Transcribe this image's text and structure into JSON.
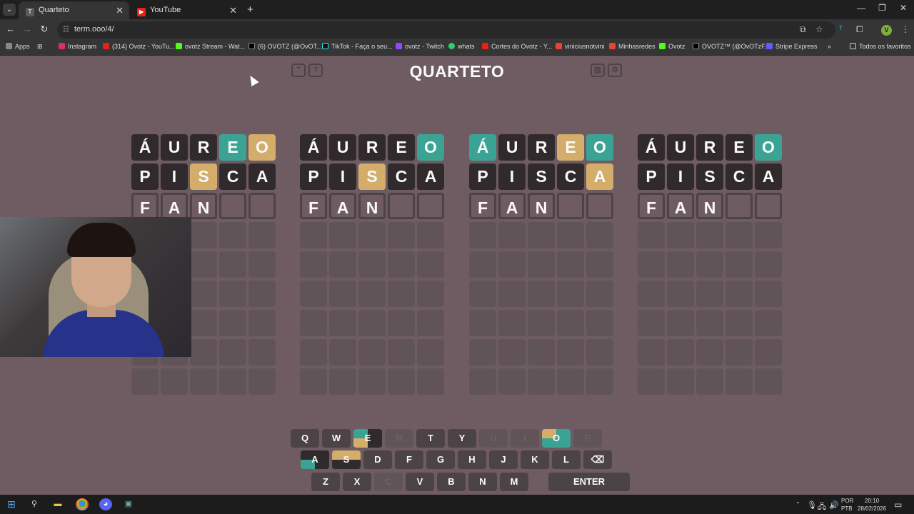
{
  "browser": {
    "tabs": [
      {
        "title": "Quarteto",
        "favicon": "T",
        "active": true
      },
      {
        "title": "YouTube",
        "favicon": "▶",
        "active": false
      }
    ],
    "url": "term.ooo/4/",
    "profile_initial": "V",
    "bookmarks": [
      {
        "label": "Apps",
        "icon": "apps-icon"
      },
      {
        "label": "Instagram",
        "icon": "instagram-icon"
      },
      {
        "label": "(314) Ovotz - YouTu...",
        "icon": "youtube-icon"
      },
      {
        "label": "ovotz Stream - Wat...",
        "icon": "kick-icon"
      },
      {
        "label": "(6) OVOTZ (@OvOT...",
        "icon": "x-icon"
      },
      {
        "label": "TikTok - Faça o seu...",
        "icon": "tiktok-icon"
      },
      {
        "label": "ovotz - Twitch",
        "icon": "twitch-icon"
      },
      {
        "label": "whats",
        "icon": "whatsapp-icon"
      },
      {
        "label": "Cortes do Ovotz - Y...",
        "icon": "youtube-icon"
      },
      {
        "label": "viniciusnotvini",
        "icon": "gmail-icon"
      },
      {
        "label": "Minhasredes",
        "icon": "gmail-icon"
      },
      {
        "label": "Ovotz",
        "icon": "kick-icon"
      },
      {
        "label": "OVOTZ™ (@OvOTzF...",
        "icon": "x-icon"
      },
      {
        "label": "Stripe Express",
        "icon": "stripe-icon"
      }
    ],
    "all_bookmarks_label": "Todos os favoritos"
  },
  "game": {
    "title": "QUARTETO",
    "colors": {
      "correct": "#3aa394",
      "present": "#d3ad69",
      "absent": "#312a2c",
      "background": "#6e5c62"
    },
    "boards": [
      {
        "rows": [
          [
            {
              "l": "Á",
              "s": "miss"
            },
            {
              "l": "U",
              "s": "miss"
            },
            {
              "l": "R",
              "s": "miss"
            },
            {
              "l": "E",
              "s": "ok"
            },
            {
              "l": "O",
              "s": "near"
            }
          ],
          [
            {
              "l": "P",
              "s": "miss"
            },
            {
              "l": "I",
              "s": "miss"
            },
            {
              "l": "S",
              "s": "near"
            },
            {
              "l": "C",
              "s": "miss"
            },
            {
              "l": "A",
              "s": "miss"
            }
          ],
          [
            {
              "l": "F",
              "s": "empty"
            },
            {
              "l": "A",
              "s": "empty"
            },
            {
              "l": "N",
              "s": "empty"
            },
            {
              "l": "",
              "s": "empty"
            },
            {
              "l": "",
              "s": "empty"
            }
          ]
        ]
      },
      {
        "rows": [
          [
            {
              "l": "Á",
              "s": "miss"
            },
            {
              "l": "U",
              "s": "miss"
            },
            {
              "l": "R",
              "s": "miss"
            },
            {
              "l": "E",
              "s": "miss"
            },
            {
              "l": "O",
              "s": "ok"
            }
          ],
          [
            {
              "l": "P",
              "s": "miss"
            },
            {
              "l": "I",
              "s": "miss"
            },
            {
              "l": "S",
              "s": "near"
            },
            {
              "l": "C",
              "s": "miss"
            },
            {
              "l": "A",
              "s": "miss"
            }
          ],
          [
            {
              "l": "F",
              "s": "empty"
            },
            {
              "l": "A",
              "s": "empty"
            },
            {
              "l": "N",
              "s": "empty"
            },
            {
              "l": "",
              "s": "empty"
            },
            {
              "l": "",
              "s": "empty"
            }
          ]
        ]
      },
      {
        "rows": [
          [
            {
              "l": "Á",
              "s": "ok"
            },
            {
              "l": "U",
              "s": "miss"
            },
            {
              "l": "R",
              "s": "miss"
            },
            {
              "l": "E",
              "s": "near"
            },
            {
              "l": "O",
              "s": "ok"
            }
          ],
          [
            {
              "l": "P",
              "s": "miss"
            },
            {
              "l": "I",
              "s": "miss"
            },
            {
              "l": "S",
              "s": "miss"
            },
            {
              "l": "C",
              "s": "miss"
            },
            {
              "l": "A",
              "s": "near"
            }
          ],
          [
            {
              "l": "F",
              "s": "empty"
            },
            {
              "l": "A",
              "s": "empty"
            },
            {
              "l": "N",
              "s": "empty"
            },
            {
              "l": "",
              "s": "empty"
            },
            {
              "l": "",
              "s": "empty"
            }
          ]
        ]
      },
      {
        "rows": [
          [
            {
              "l": "Á",
              "s": "miss"
            },
            {
              "l": "U",
              "s": "miss"
            },
            {
              "l": "R",
              "s": "miss"
            },
            {
              "l": "E",
              "s": "miss"
            },
            {
              "l": "O",
              "s": "ok"
            }
          ],
          [
            {
              "l": "P",
              "s": "miss"
            },
            {
              "l": "I",
              "s": "miss"
            },
            {
              "l": "S",
              "s": "miss"
            },
            {
              "l": "C",
              "s": "miss"
            },
            {
              "l": "A",
              "s": "miss"
            }
          ],
          [
            {
              "l": "F",
              "s": "empty"
            },
            {
              "l": "A",
              "s": "empty"
            },
            {
              "l": "N",
              "s": "empty"
            },
            {
              "l": "",
              "s": "empty"
            },
            {
              "l": "",
              "s": "empty"
            }
          ]
        ]
      }
    ],
    "total_rows": 9,
    "keyboard": {
      "row1": [
        {
          "k": "Q",
          "st": "normal"
        },
        {
          "k": "W",
          "st": "normal"
        },
        {
          "k": "E",
          "st": "split",
          "q": [
            "ok",
            "miss",
            "near",
            "miss"
          ]
        },
        {
          "k": "R",
          "st": "used"
        },
        {
          "k": "T",
          "st": "normal"
        },
        {
          "k": "Y",
          "st": "normal"
        },
        {
          "k": "U",
          "st": "used"
        },
        {
          "k": "I",
          "st": "used"
        },
        {
          "k": "O",
          "st": "split",
          "q": [
            "near",
            "ok",
            "ok",
            "ok"
          ]
        },
        {
          "k": "P",
          "st": "used"
        }
      ],
      "row2": [
        {
          "k": "A",
          "st": "split",
          "q": [
            "miss",
            "miss",
            "ok",
            "miss"
          ]
        },
        {
          "k": "S",
          "st": "split",
          "q": [
            "near",
            "near",
            "miss",
            "miss"
          ]
        },
        {
          "k": "D",
          "st": "normal"
        },
        {
          "k": "F",
          "st": "normal"
        },
        {
          "k": "G",
          "st": "normal"
        },
        {
          "k": "H",
          "st": "normal"
        },
        {
          "k": "J",
          "st": "normal"
        },
        {
          "k": "K",
          "st": "normal"
        },
        {
          "k": "L",
          "st": "normal"
        },
        {
          "k": "⌫",
          "st": "normal"
        }
      ],
      "row3": [
        {
          "k": "Z",
          "st": "normal"
        },
        {
          "k": "X",
          "st": "normal"
        },
        {
          "k": "C",
          "st": "used"
        },
        {
          "k": "V",
          "st": "normal"
        },
        {
          "k": "B",
          "st": "normal"
        },
        {
          "k": "N",
          "st": "normal"
        },
        {
          "k": "M",
          "st": "normal"
        },
        {
          "k": "ENTER",
          "st": "normal"
        }
      ]
    }
  },
  "taskbar": {
    "lang": "POR",
    "layout": "PTB",
    "time": "20:10",
    "date": "28/02/2026"
  }
}
